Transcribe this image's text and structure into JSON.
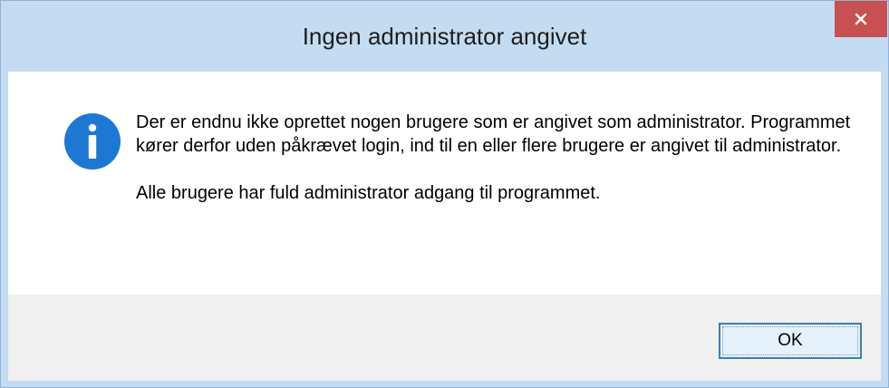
{
  "dialog": {
    "title": "Ingen administrator angivet",
    "close_icon": "close-icon",
    "info_icon": "info-icon",
    "message_paragraph_1": "Der er endnu ikke oprettet nogen brugere som er angivet som administrator. Programmet kører derfor uden påkrævet login, ind til en eller flere brugere er angivet til administrator.",
    "message_paragraph_2": "Alle brugere har fuld administrator adgang til programmet.",
    "ok_label": "OK"
  },
  "colors": {
    "frame": "#c4dcf2",
    "close_button": "#c75050",
    "info_icon": "#1c78d3",
    "footer": "#f0f0f0",
    "ok_border": "#3c7fb1"
  }
}
